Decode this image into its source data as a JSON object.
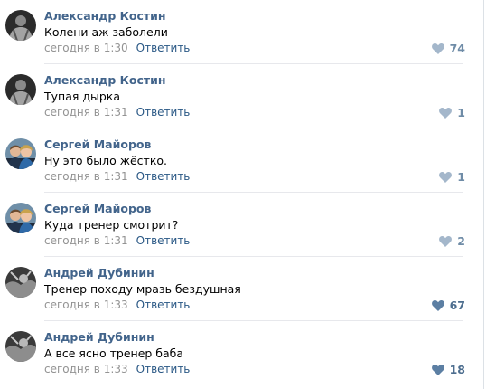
{
  "colors": {
    "author": "#42648b",
    "reply_link": "#2a5885",
    "timestamp": "#939393",
    "like_light": "#a4b7cb",
    "like_strong": "#5c7fa3",
    "divider": "#e7e8ec"
  },
  "comments": [
    {
      "author": "Александр Костин",
      "text": "Колени аж заболели",
      "time": "сегодня в 1:30",
      "reply": "Ответить",
      "likes": "74",
      "like_icon": "heart-icon",
      "avatar": "dark-photo"
    },
    {
      "author": "Александр Костин",
      "text": "Тупая дырка",
      "time": "сегодня в 1:31",
      "reply": "Ответить",
      "likes": "1",
      "like_icon": "heart-icon",
      "avatar": "dark-photo"
    },
    {
      "author": "Сергей Майоров",
      "text": "Ну это было жёстко.",
      "time": "сегодня в 1:31",
      "reply": "Ответить",
      "likes": "1",
      "like_icon": "heart-icon",
      "avatar": "couple-photo"
    },
    {
      "author": "Сергей Майоров",
      "text": "Куда тренер смотрит?",
      "time": "сегодня в 1:31",
      "reply": "Ответить",
      "likes": "2",
      "like_icon": "heart-icon",
      "avatar": "couple-photo"
    },
    {
      "author": "Андрей Дубинин",
      "text": "Тренер походу мразь бездушная",
      "time": "сегодня в 1:33",
      "reply": "Ответить",
      "likes": "67",
      "like_icon": "heart-icon",
      "avatar": "grey-photo"
    },
    {
      "author": "Андрей Дубинин",
      "text": "А все ясно тренер баба",
      "time": "сегодня в 1:33",
      "reply": "Ответить",
      "likes": "18",
      "like_icon": "heart-icon",
      "avatar": "grey-photo"
    }
  ]
}
